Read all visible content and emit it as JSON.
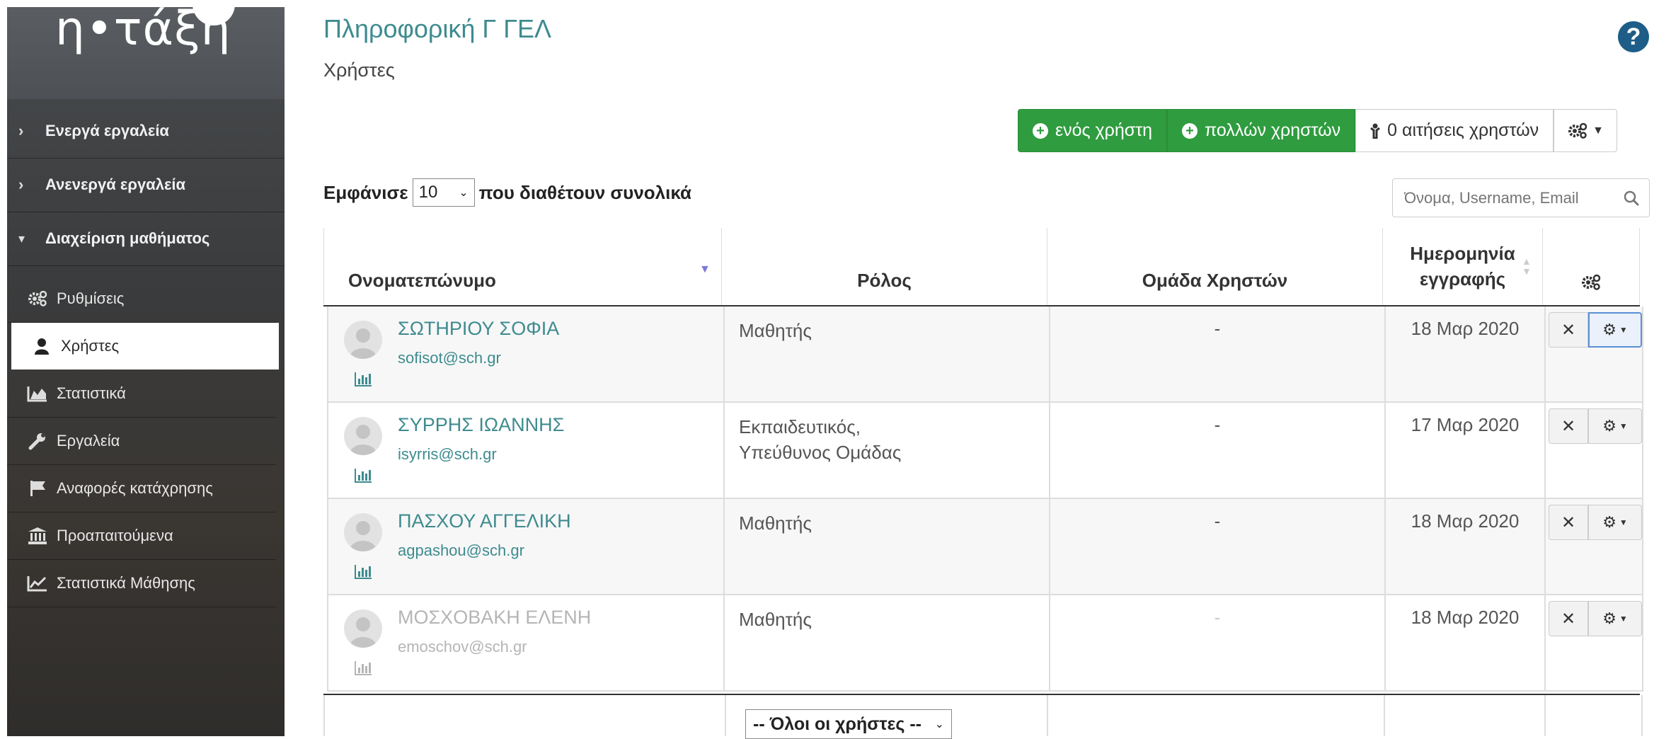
{
  "sidebar": {
    "logo": "η•τάξη",
    "sections": [
      {
        "label": "Ενεργά εργαλεία",
        "expanded": false
      },
      {
        "label": "Ανενεργά εργαλεία",
        "expanded": false
      },
      {
        "label": "Διαχείριση μαθήματος",
        "expanded": true
      }
    ],
    "items": [
      {
        "label": "Ρυθμίσεις",
        "icon": "gears-icon"
      },
      {
        "label": "Χρήστες",
        "icon": "user-icon",
        "active": true
      },
      {
        "label": "Στατιστικά",
        "icon": "area-chart-icon"
      },
      {
        "label": "Εργαλεία",
        "icon": "wrench-icon"
      },
      {
        "label": "Αναφορές κατάχρησης",
        "icon": "flag-icon"
      },
      {
        "label": "Προαπαιτούμενα",
        "icon": "institution-icon"
      },
      {
        "label": "Στατιστικά Μάθησης",
        "icon": "line-chart-icon"
      }
    ]
  },
  "header": {
    "course_title": "Πληροφορική Γ ΓΕΛ",
    "page_title": "Χρήστες",
    "help": "?"
  },
  "toolbar": {
    "add_one": "ενός χρήστη",
    "add_many": "πολλών χρηστών",
    "requests": "0 αιτήσεις χρηστών"
  },
  "listing": {
    "show_label": "Εμφάνισε",
    "page_size": "10",
    "total_label": "που διαθέτουν συνολικά",
    "search_placeholder": "Όνομα, Username, Email"
  },
  "table": {
    "columns": {
      "name": "Ονοματεπώνυμο",
      "role": "Ρόλος",
      "group": "Ομάδα Χρηστών",
      "date_line1": "Ημερομηνία",
      "date_line2": "εγγραφής"
    },
    "rows": [
      {
        "name": "ΣΩΤΗΡΙΟΥ ΣΟΦΙΑ",
        "email": "sofisot@sch.gr",
        "role_line1": "Μαθητής",
        "role_line2": "",
        "group": "-",
        "date": "18 Μαρ 2020",
        "active": true
      },
      {
        "name": "ΣΥΡΡΗΣ ΙΩΑΝΝΗΣ",
        "email": "isyrris@sch.gr",
        "role_line1": "Εκπαιδευτικός,",
        "role_line2": "Υπεύθυνος Ομάδας",
        "group": "-",
        "date": "17 Μαρ 2020",
        "active": true
      },
      {
        "name": "ΠΑΣΧΟΥ ΑΓΓΕΛΙΚΗ",
        "email": "agpashou@sch.gr",
        "role_line1": "Μαθητής",
        "role_line2": "",
        "group": "-",
        "date": "18 Μαρ 2020",
        "active": true
      },
      {
        "name": "ΜΟΣΧΟΒΑΚΗ ΕΛΕΝΗ",
        "email": "emoschov@sch.gr",
        "role_line1": "Μαθητής",
        "role_line2": "",
        "group": "-",
        "date": "18 Μαρ 2020",
        "active": false
      }
    ],
    "role_filter": "-- Όλοι οι χρήστες --"
  },
  "colors": {
    "accent_teal": "#3e8b8f",
    "button_green": "#2f9c3f",
    "help_blue": "#1d5d87"
  }
}
